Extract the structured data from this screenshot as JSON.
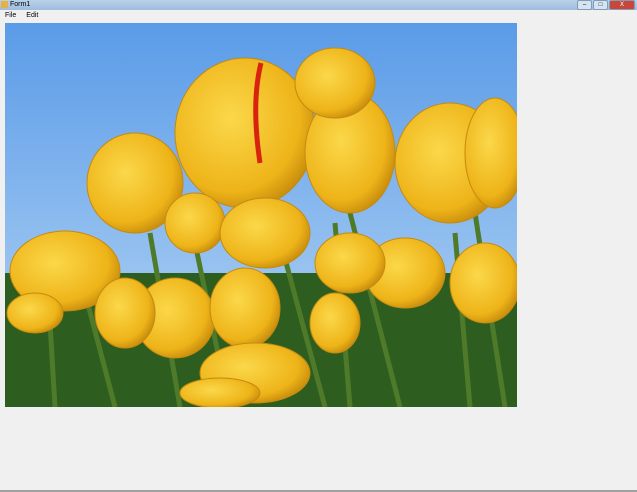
{
  "window": {
    "title": "Form1",
    "minimize": "–",
    "maximize": "□",
    "close": "X"
  },
  "menu": [
    {
      "label": "File"
    },
    {
      "label": "Edit"
    }
  ],
  "picture": {
    "subject": "yellow tulips under blue sky"
  }
}
